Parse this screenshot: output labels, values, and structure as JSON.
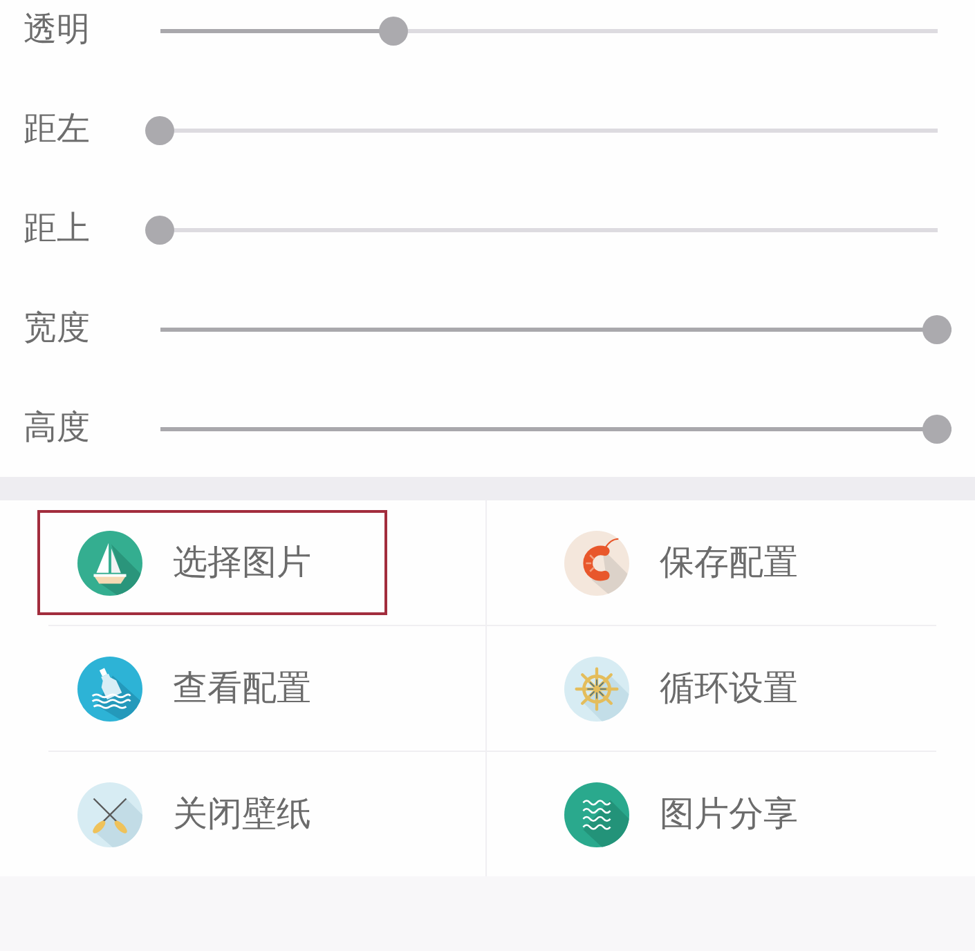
{
  "sliders": [
    {
      "label": "透明",
      "level": 0.3
    },
    {
      "label": "距左",
      "level": 0
    },
    {
      "label": "距上",
      "level": 0
    },
    {
      "label": "宽度",
      "level": 1
    },
    {
      "label": "高度",
      "level": 1
    }
  ],
  "actions": [
    {
      "label": "选择图片",
      "selected": true
    },
    {
      "label": "保存配置",
      "selected": false
    },
    {
      "label": "查看配置",
      "selected": false
    },
    {
      "label": "循环设置",
      "selected": false
    },
    {
      "label": "关闭壁纸",
      "selected": false
    },
    {
      "label": "图片分享",
      "selected": false
    }
  ]
}
